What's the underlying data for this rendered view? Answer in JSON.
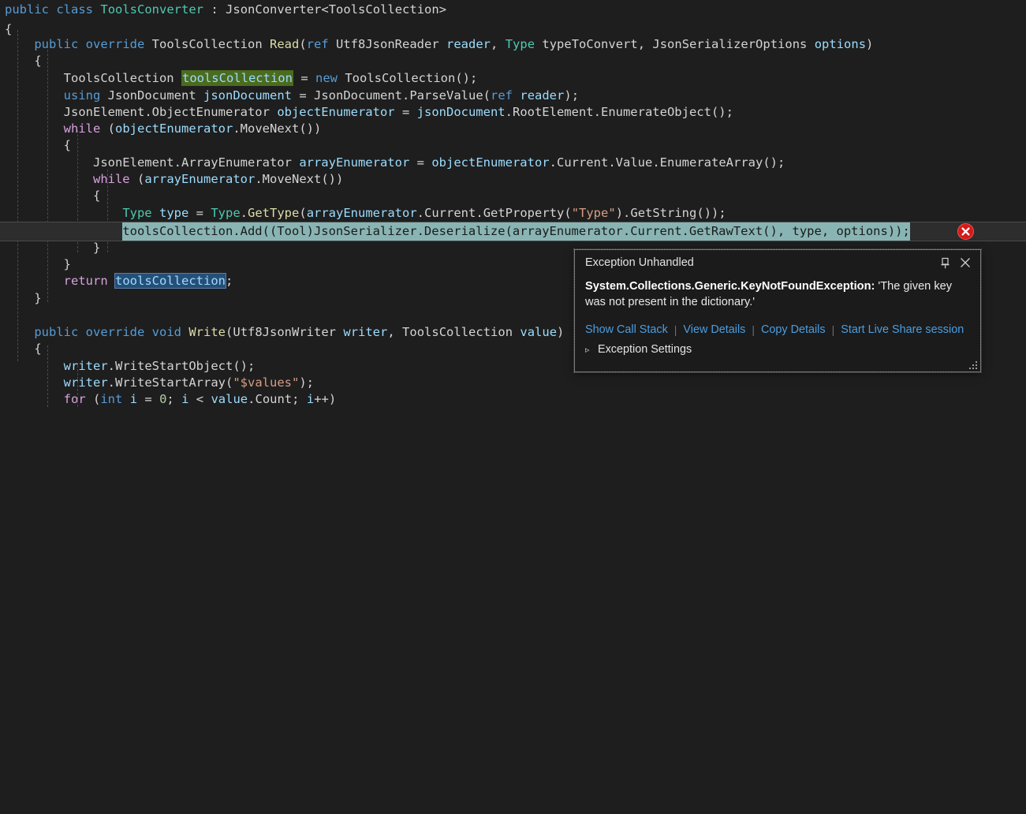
{
  "editor": {
    "language": "csharp",
    "theme": "vs-dark",
    "background": "#1e1e1e",
    "colors": {
      "keyword": "#569cd6",
      "control_keyword": "#d8a0df",
      "type": "#4ec9b0",
      "method": "#dcdcaa",
      "variable": "#9cdcfe",
      "string": "#d69d85",
      "number": "#b5cea8",
      "plain": "#d4d4d4",
      "definition_highlight": "#4b6b1f",
      "selection_highlight": "#264f78",
      "execution_highlight": "#89b4b4",
      "error_glyph": "#d11b1b"
    },
    "lines": [
      "public class ToolsConverter : JsonConverter<ToolsCollection>",
      "{",
      "    public override ToolsCollection Read(ref Utf8JsonReader reader, Type typeToConvert, JsonSerializerOptions options)",
      "    {",
      "        ToolsCollection toolsCollection = new ToolsCollection();",
      "        using JsonDocument jsonDocument = JsonDocument.ParseValue(ref reader);",
      "        JsonElement.ObjectEnumerator objectEnumerator = jsonDocument.RootElement.EnumerateObject();",
      "        while (objectEnumerator.MoveNext())",
      "        {",
      "            JsonElement.ArrayEnumerator arrayEnumerator = objectEnumerator.Current.Value.EnumerateArray();",
      "            while (arrayEnumerator.MoveNext())",
      "            {",
      "                Type type = Type.GetType(arrayEnumerator.Current.GetProperty(\"Type\").GetString());",
      "                toolsCollection.Add((Tool)JsonSerializer.Deserialize(arrayEnumerator.Current.GetRawText(), type, options));",
      "            }",
      "        }",
      "        return toolsCollection;",
      "    }",
      "",
      "    public override void Write(Utf8JsonWriter writer, ToolsCollection value)",
      "    {",
      "        writer.WriteStartObject();",
      "        writer.WriteStartArray(\"$values\");",
      "        for (int i = 0; i < value.Count; i++)"
    ],
    "current_execution_line": "toolsCollection.Add((Tool)JsonSerializer.Deserialize(arrayEnumerator.Current.GetRawText(), type, options));",
    "selected_symbol": "toolsCollection"
  },
  "error_glyph": {
    "name": "error-icon",
    "tooltip": "Exception Unhandled"
  },
  "exception_popup": {
    "title": "Exception Unhandled",
    "pin_icon": "pin-icon",
    "close_icon": "close-icon",
    "exception_type": "System.Collections.Generic.KeyNotFoundException:",
    "exception_detail": "'The given key was not present in the dictionary.'",
    "links": [
      "Show Call Stack",
      "View Details",
      "Copy Details",
      "Start Live Share session"
    ],
    "link_separator": "|",
    "settings_label": "Exception Settings",
    "settings_chevron": "▹",
    "resize_grip": "resize-grip-icon"
  }
}
